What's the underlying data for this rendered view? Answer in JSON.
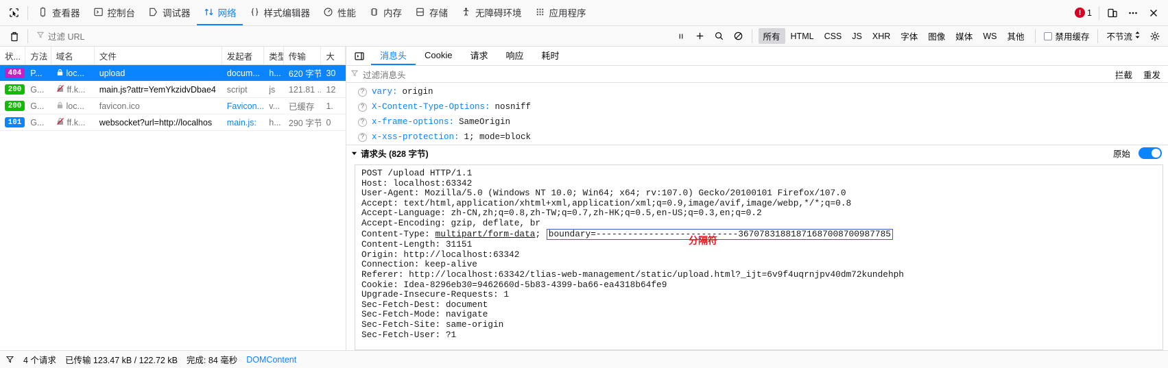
{
  "toolbar": {
    "picker_icon": "element-picker-icon",
    "tabs": [
      {
        "label": "查看器",
        "icon": "inspector-icon",
        "active": false
      },
      {
        "label": "控制台",
        "icon": "console-icon",
        "active": false
      },
      {
        "label": "调试器",
        "icon": "debugger-icon",
        "active": false
      },
      {
        "label": "网络",
        "icon": "network-icon",
        "active": true
      },
      {
        "label": "样式编辑器",
        "icon": "style-editor-icon",
        "active": false
      },
      {
        "label": "性能",
        "icon": "performance-icon",
        "active": false
      },
      {
        "label": "内存",
        "icon": "memory-icon",
        "active": false
      },
      {
        "label": "存储",
        "icon": "storage-icon",
        "active": false
      },
      {
        "label": "无障碍环境",
        "icon": "accessibility-icon",
        "active": false
      },
      {
        "label": "应用程序",
        "icon": "application-icon",
        "active": false
      }
    ],
    "error_count": "1",
    "responsive_icon": "responsive-design-mode-icon",
    "meatball_icon": "more-options-icon",
    "close_icon": "close-icon",
    "accent_color": "#0a84ff",
    "error_color": "#d70022"
  },
  "network_toolbar": {
    "clear_icon": "trash-icon",
    "filter_icon": "funnel-icon",
    "filter_placeholder": "过滤 URL",
    "pause_icon": "pause-icon",
    "plus_icon": "plus-icon",
    "search_icon": "search-icon",
    "block_icon": "no-entry-icon",
    "types": [
      "所有",
      "HTML",
      "CSS",
      "JS",
      "XHR",
      "字体",
      "图像",
      "媒体",
      "WS",
      "其他"
    ],
    "active_type": "所有",
    "disable_cache_label": "禁用缓存",
    "disable_cache_icon": "cache-icon",
    "throttle_label": "不节流",
    "throttle_icon": "chevron-updown-icon",
    "settings_icon": "gear-icon"
  },
  "request_table": {
    "columns": [
      "状...",
      "方法",
      "域名",
      "文件",
      "发起者",
      "类型",
      "传输",
      "大"
    ],
    "rows": [
      {
        "status": "404",
        "status_class": "b-404",
        "method": "P...",
        "lock": "lock-icon",
        "domain": "loc...",
        "file": "upload",
        "initiator": "docum...",
        "type": "h...",
        "transfer": "620 字节",
        "size": "30",
        "selected": true
      },
      {
        "status": "200",
        "status_class": "b-200",
        "method": "G...",
        "lock": "lock-crossed-icon",
        "domain": "ff.k...",
        "file": "main.js?attr=YemYkzidvDbae4",
        "initiator": "script",
        "type": "js",
        "transfer": "121.81 ...",
        "size": "12",
        "selected": false
      },
      {
        "status": "200",
        "status_class": "b-200",
        "method": "G...",
        "lock": "lock-icon",
        "domain": "loc...",
        "file": "favicon.ico",
        "initiator": "Favicon...",
        "type": "v...",
        "transfer": "已缓存",
        "size": "1.",
        "selected": false
      },
      {
        "status": "101",
        "status_class": "b-101",
        "method": "G...",
        "lock": "lock-crossed-icon",
        "domain": "ff.k...",
        "file": "websocket?url=http://localhos",
        "initiator": "main.js:",
        "type": "h...",
        "transfer": "290 字节",
        "size": "0",
        "selected": false
      }
    ]
  },
  "status_bar": {
    "funnel_icon": "funnel-icon",
    "request_count": "4 个请求",
    "transferred": "已传输 123.47 kB / 122.72 kB",
    "finish": "完成: 84 毫秒",
    "domcontent": "DOMContent"
  },
  "details": {
    "collapse_icon": "collapse-pane-icon",
    "tabs": [
      {
        "label": "消息头",
        "active": true
      },
      {
        "label": "Cookie",
        "active": false
      },
      {
        "label": "请求",
        "active": false
      },
      {
        "label": "响应",
        "active": false
      },
      {
        "label": "耗时",
        "active": false
      }
    ],
    "filter": {
      "icon": "funnel-icon",
      "placeholder": "过滤消息头",
      "block_label": "拦截",
      "resend_label": "重发"
    },
    "response_headers": [
      {
        "name": "vary:",
        "value": "origin"
      },
      {
        "name": "X-Content-Type-Options:",
        "value": "nosniff"
      },
      {
        "name": "x-frame-options:",
        "value": "SameOrigin"
      },
      {
        "name": "x-xss-protection:",
        "value": "1; mode=block"
      }
    ],
    "request_section": {
      "twisty": "triangle-down-icon",
      "title": "请求头 (828 字节)",
      "raw_label": "原始",
      "raw_enabled": true
    },
    "raw_lines": [
      "POST /upload HTTP/1.1",
      "Host: localhost:63342",
      "User-Agent: Mozilla/5.0 (Windows NT 10.0; Win64; x64; rv:107.0) Gecko/20100101 Firefox/107.0",
      "Accept: text/html,application/xhtml+xml,application/xml;q=0.9,image/avif,image/webp,*/*;q=0.8",
      "Accept-Language: zh-CN,zh;q=0.8,zh-TW;q=0.7,zh-HK;q=0.5,en-US;q=0.3,en;q=0.2",
      "Accept-Encoding: gzip, deflate, br"
    ],
    "content_type_line": {
      "prefix": "Content-Type: ",
      "underlined": "multipart/form-data",
      "semicolon": "; ",
      "boundary": "boundary=---------------------------36707831881871687008700987785"
    },
    "raw_lines_after": [
      "Content-Length: 31151",
      "Origin: http://localhost:63342",
      "Connection: keep-alive",
      "Referer: http://localhost:63342/tlias-web-management/static/upload.html?_ijt=6v9f4uqrnjpv40dm72kundehph",
      "Cookie: Idea-8296eb30=9462660d-5b83-4399-ba66-ea4318b64fe9",
      "Upgrade-Insecure-Requests: 1",
      "Sec-Fetch-Dest: document",
      "Sec-Fetch-Mode: navigate",
      "Sec-Fetch-Site: same-origin",
      "Sec-Fetch-User: ?1"
    ],
    "annotation": {
      "text": "分隔符",
      "color": "#e01b24"
    }
  }
}
